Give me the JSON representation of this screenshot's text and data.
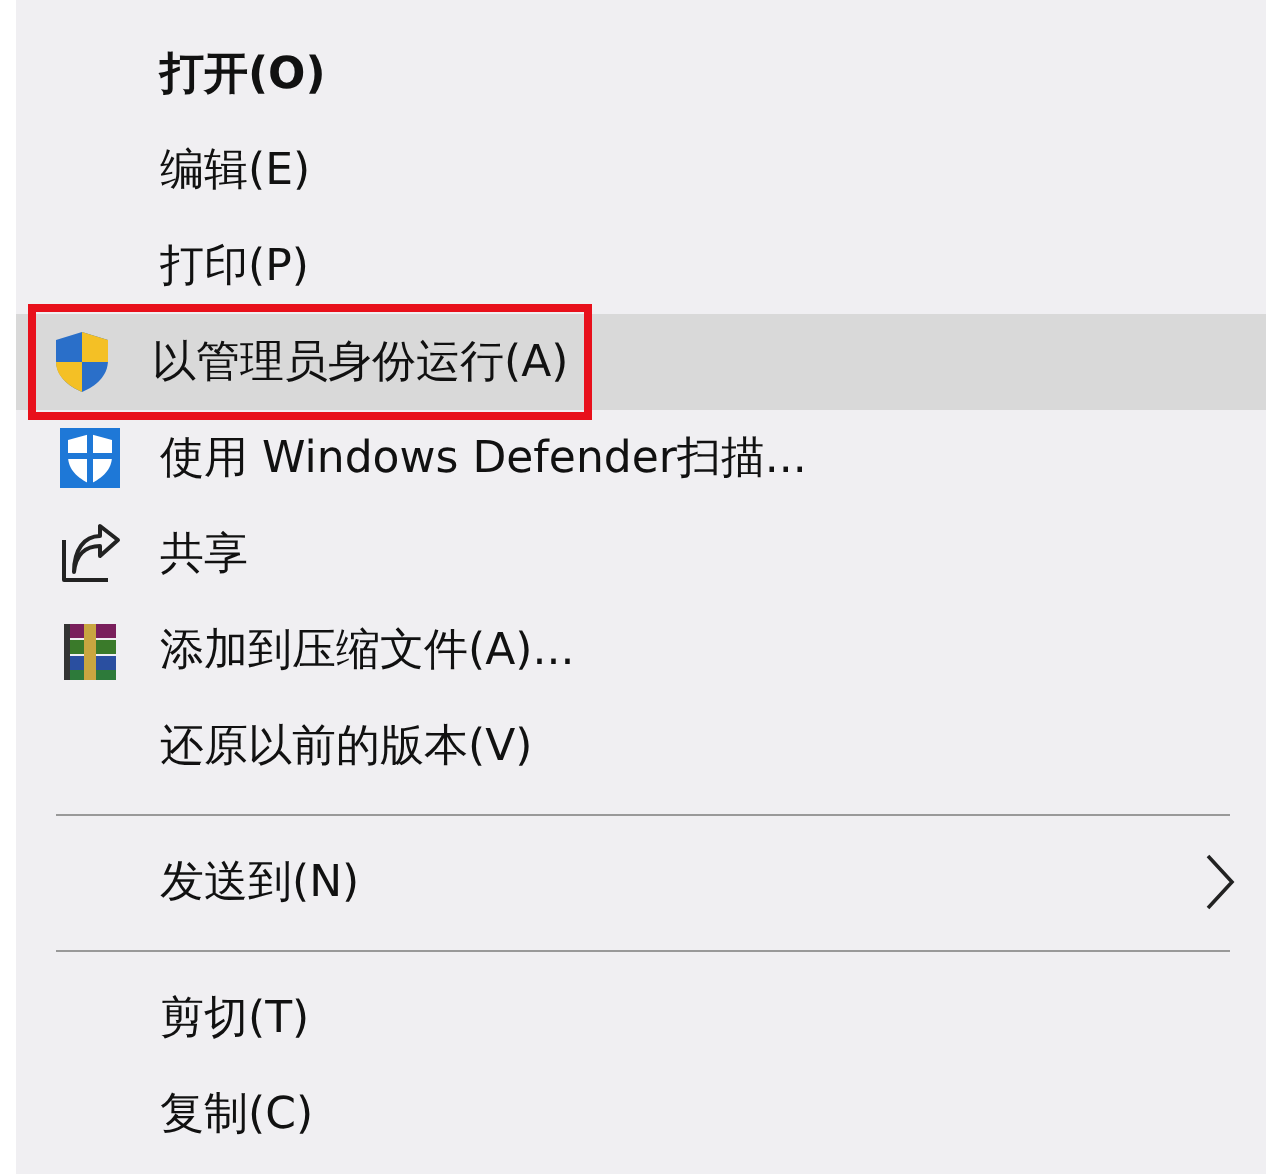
{
  "context_menu": {
    "items": [
      {
        "kind": "item",
        "label": "打开(O)",
        "bold": true,
        "selected": false
      },
      {
        "kind": "item",
        "label": "编辑(E)",
        "selected": false
      },
      {
        "kind": "item",
        "label": "打印(P)",
        "selected": false
      },
      {
        "kind": "uac",
        "label": "以管理员身份运行(A)",
        "selected": true,
        "outlined": true
      },
      {
        "kind": "defender",
        "label": "使用 Windows Defender扫描...",
        "selected": false
      },
      {
        "kind": "share",
        "label": "共享",
        "selected": false
      },
      {
        "kind": "archive",
        "label": "添加到压缩文件(A)...",
        "selected": false
      },
      {
        "kind": "item",
        "label": "还原以前的版本(V)",
        "selected": false
      },
      {
        "kind": "separator"
      },
      {
        "kind": "submenu",
        "label": "发送到(N)",
        "selected": false
      },
      {
        "kind": "separator"
      },
      {
        "kind": "item",
        "label": "剪切(T)",
        "selected": false
      },
      {
        "kind": "item",
        "label": "复制(C)",
        "selected": false
      }
    ]
  }
}
